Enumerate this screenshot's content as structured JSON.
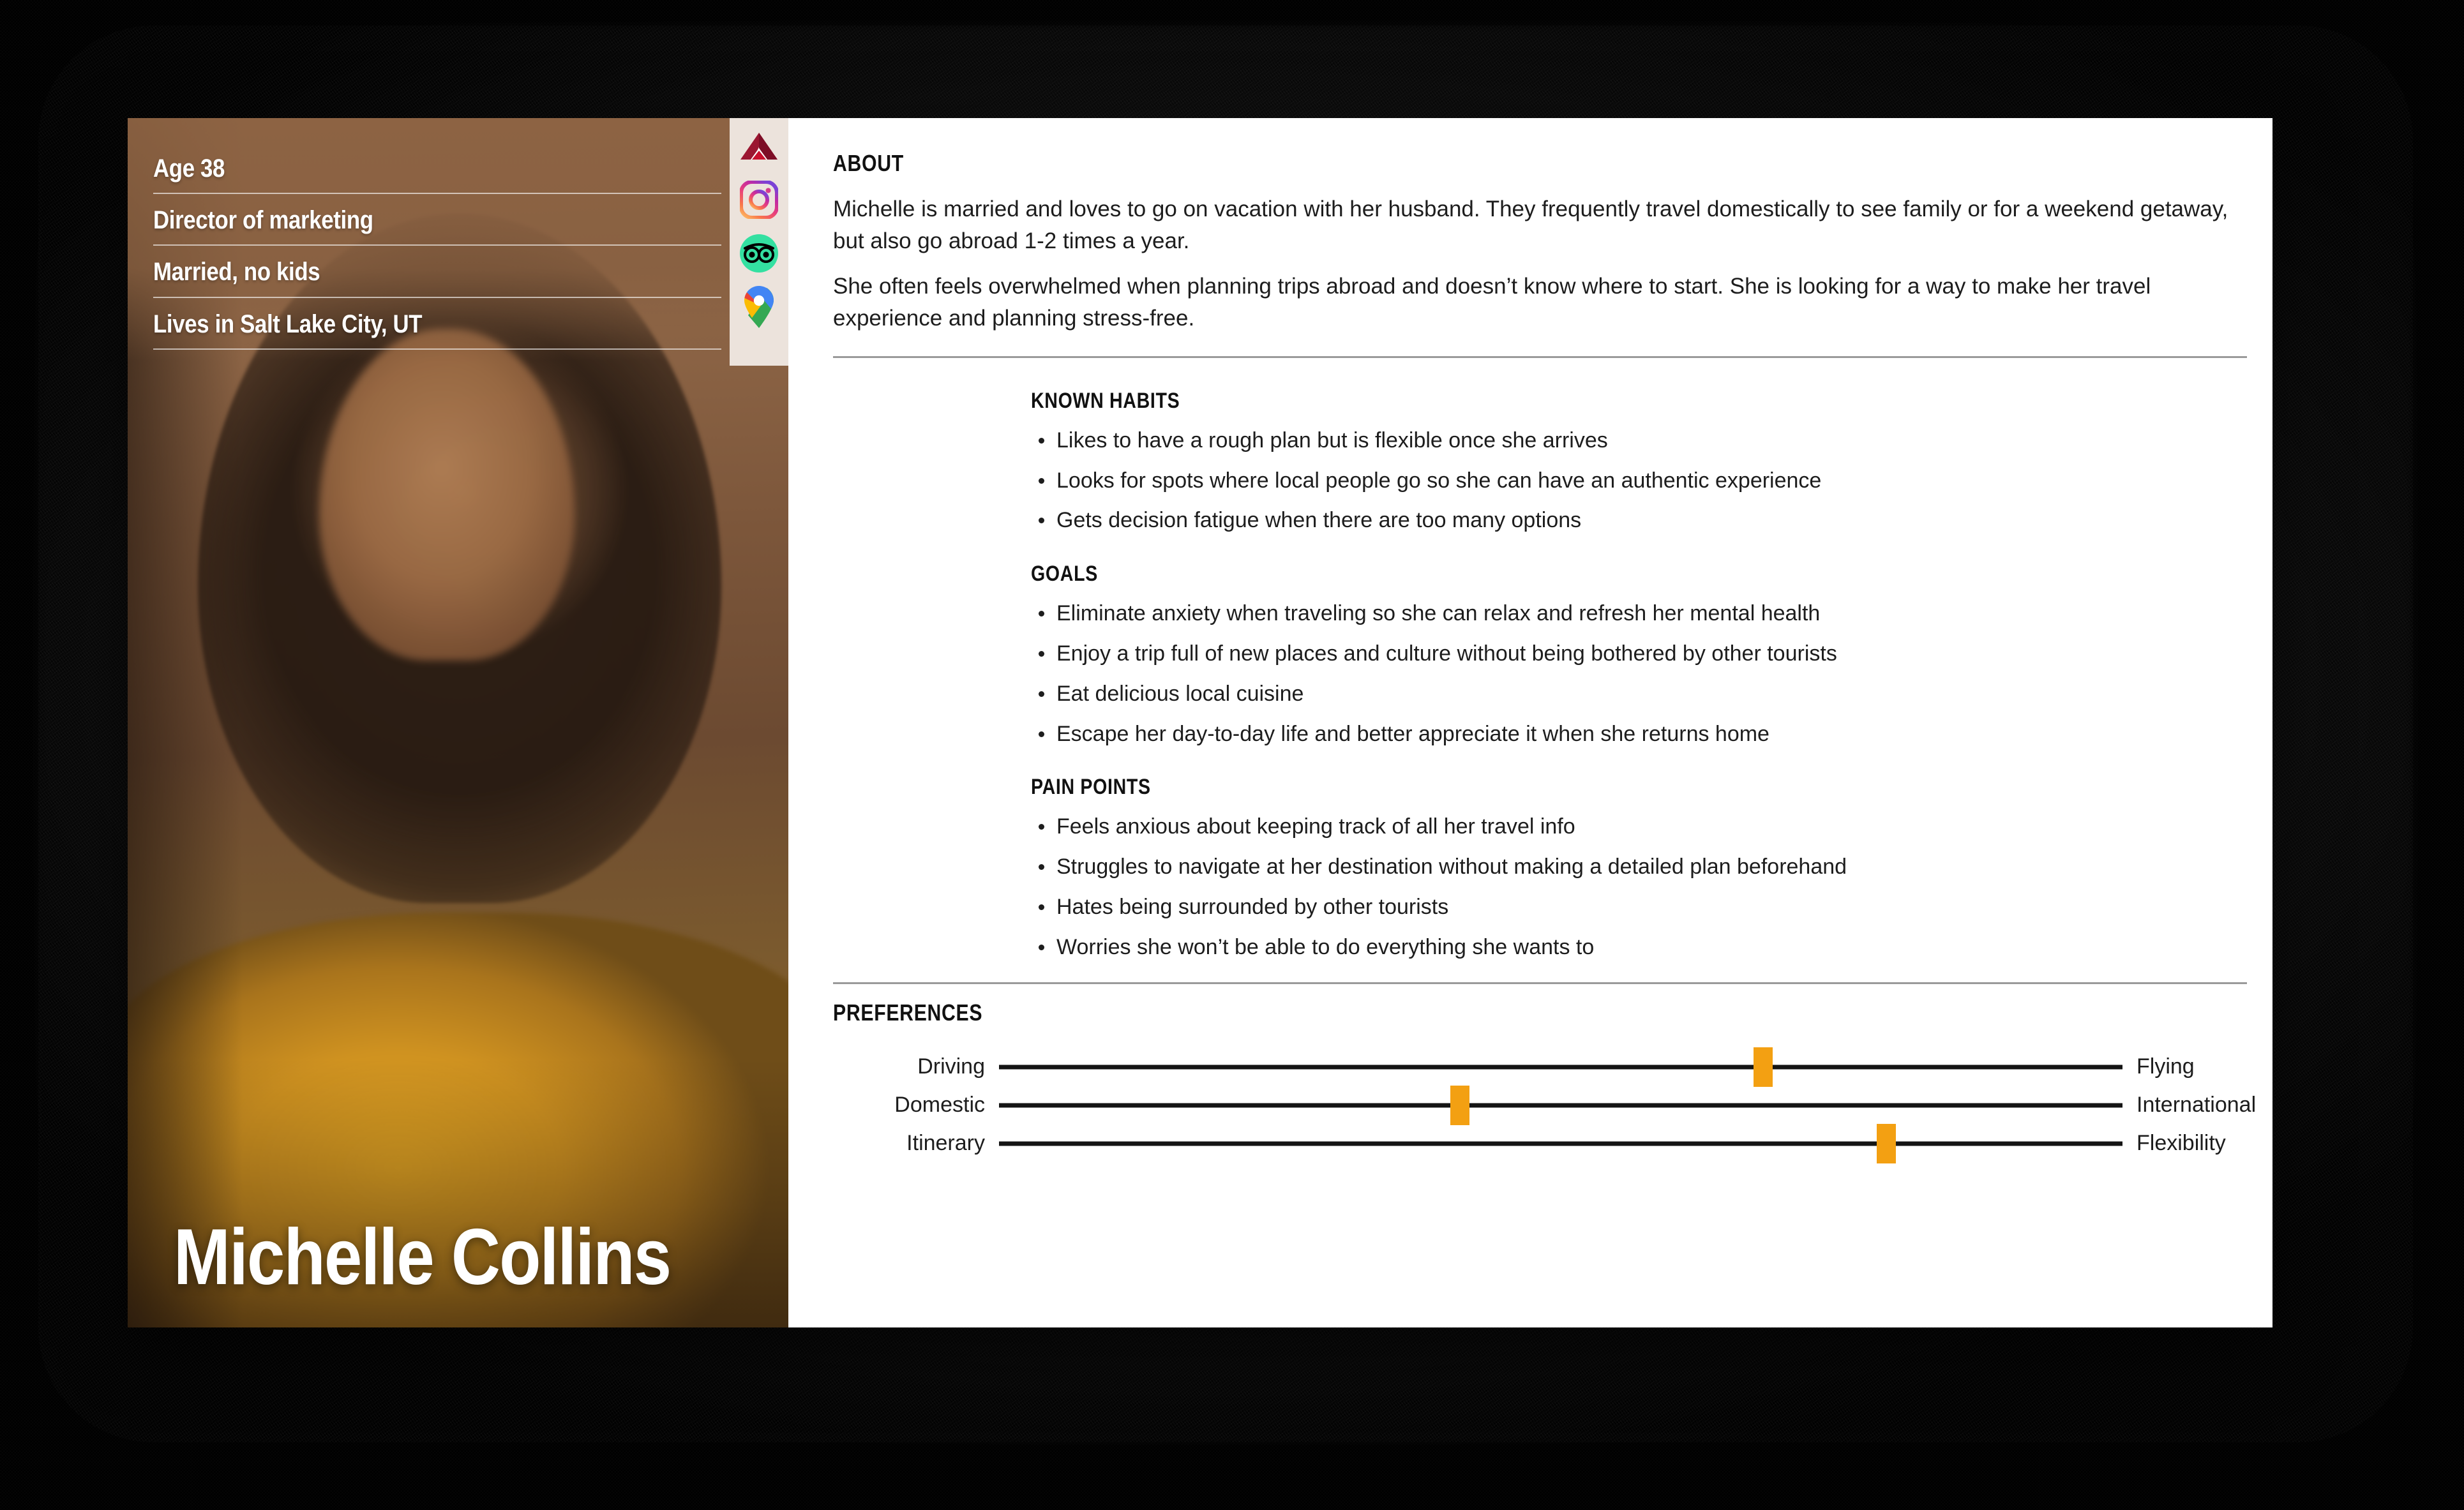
{
  "persona": {
    "name": "Michelle Collins",
    "facts": [
      "Age 38",
      "Director of marketing",
      "Married, no kids",
      "Lives in Salt Lake City, UT"
    ],
    "brand_icons": [
      "delta-airlines-icon",
      "instagram-icon",
      "tripadvisor-icon",
      "google-maps-icon"
    ]
  },
  "about": {
    "heading": "ABOUT",
    "paragraphs": [
      "Michelle is married and loves to go on vacation with her husband. They frequently travel domestically to see family or for a weekend getaway, but also go abroad 1-2 times a year.",
      "She often feels overwhelmed when planning trips abroad and doesn’t know where to start. She is looking for a way to make her travel experience and planning stress-free."
    ]
  },
  "known_habits": {
    "heading": "KNOWN HABITS",
    "items": [
      "Likes to have a rough plan but is flexible once she arrives",
      "Looks for spots where local people go so she can have an authentic experience",
      "Gets decision fatigue when there are too many options"
    ]
  },
  "goals": {
    "heading": "GOALS",
    "items": [
      "Eliminate anxiety when traveling so she can relax and refresh her mental health",
      "Enjoy a trip full of new places and culture without being bothered by other tourists",
      "Eat delicious local cuisine",
      "Escape her day-to-day life and better appreciate it when she returns home"
    ]
  },
  "pain_points": {
    "heading": "PAIN POINTS",
    "items": [
      "Feels anxious about keeping track of all her travel info",
      "Struggles to navigate at her destination without making a detailed plan beforehand",
      "Hates being surrounded by other tourists",
      "Worries she won’t be able to do everything she wants to"
    ]
  },
  "preferences": {
    "heading": "PREFERENCES",
    "sliders": [
      {
        "left_label": "Driving",
        "right_label": "Flying",
        "value_pct": 68
      },
      {
        "left_label": "Domestic",
        "right_label": "International",
        "value_pct": 41
      },
      {
        "left_label": "Itinerary",
        "right_label": "Flexibility",
        "value_pct": 79
      }
    ],
    "marker_color": "#f3a012",
    "track_color": "#141414"
  },
  "colors": {
    "card_background": "#ffffff",
    "photo_brown": "#8a6240",
    "rail_background": "#ece3dc",
    "divider": "#9a9a9a",
    "text": "#1d1d1d",
    "page_background": "#000000"
  }
}
